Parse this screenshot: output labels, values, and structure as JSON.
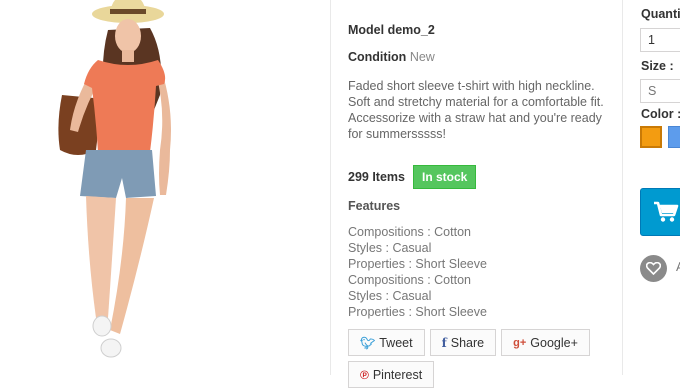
{
  "product": {
    "model": "Model demo_2",
    "condition_label": "Condition",
    "condition_value": "New",
    "description": "Faded short sleeve t-shirt with high neckline. Soft and stretchy material for a comfortable fit. Accessorize with a straw hat and you're ready for summersssss!",
    "items_count": "299 Items",
    "stock_status": "In stock"
  },
  "features": {
    "title": "Features",
    "items": [
      "Compositions : Cotton",
      "Styles : Casual",
      "Properties : Short Sleeve",
      "Compositions : Cotton",
      "Styles : Casual",
      "Properties : Short Sleeve"
    ]
  },
  "social": {
    "tweet": "Tweet",
    "share": "Share",
    "googleplus": "Google+",
    "pinterest": "Pinterest",
    "tweet_icon": "twitter-icon",
    "share_icon": "facebook-icon",
    "googleplus_icon": "google-plus-icon",
    "pinterest_icon": "pinterest-icon"
  },
  "buy_box": {
    "quantity_label": "Quantit",
    "quantity_value": "1",
    "size_label": "Size :",
    "size_value": "S",
    "color_label": "Color :",
    "colors": [
      "#f39c11",
      "#5d9cec"
    ],
    "cart_icon": "shopping-cart-icon",
    "wishlist_icon": "heart-icon",
    "wishlist_label": "A"
  },
  "theme": {
    "accent": "#009ad0",
    "in_stock": "#55c65e"
  }
}
